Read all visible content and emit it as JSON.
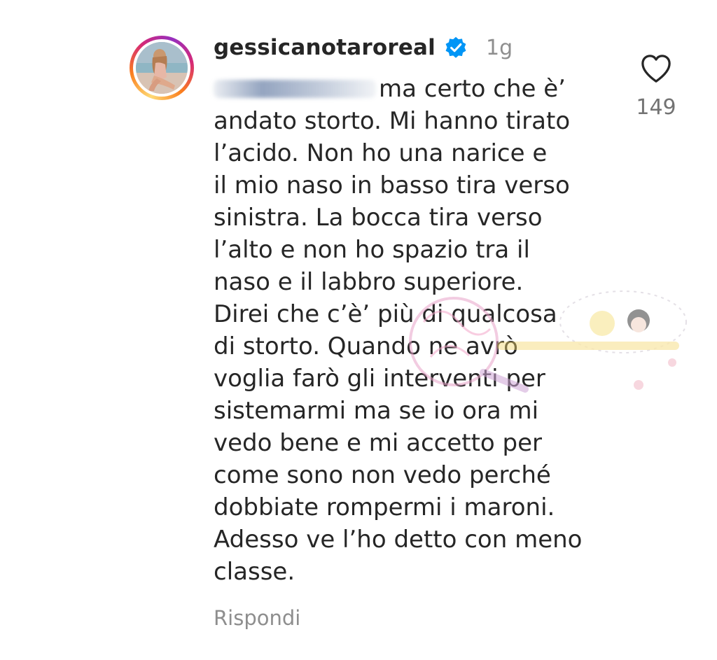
{
  "comment": {
    "username": "gessicanotaroreal",
    "verified": true,
    "time": "1g",
    "text_start": "ma certo che è’",
    "text_rest": "andato storto. Mi hanno tirato\nl’acido. Non ho una narice e\nil mio naso in basso tira verso\nsinistra. La bocca tira verso\nl’alto e non ho spazio tra il\nnaso e il labbro superiore.\nDirei che c’è’ più di qualcosa\ndi storto. Quando ne avrò\nvoglia farò gli interventi per\nsistemarmi ma se io ora mi\nvedo bene e mi accetto per\ncome sono non vedo perché\ndobbiate rompermi i maroni.\nAdesso ve l’ho detto con meno\nclasse.",
    "reply_label": "Rispondi",
    "like_count": "149"
  },
  "colors": {
    "text": "#262626",
    "muted": "#8e8e8e",
    "verified_blue": "#0095f6"
  },
  "icons": {
    "verified": "verified-badge-icon",
    "like": "heart-outline-icon"
  }
}
